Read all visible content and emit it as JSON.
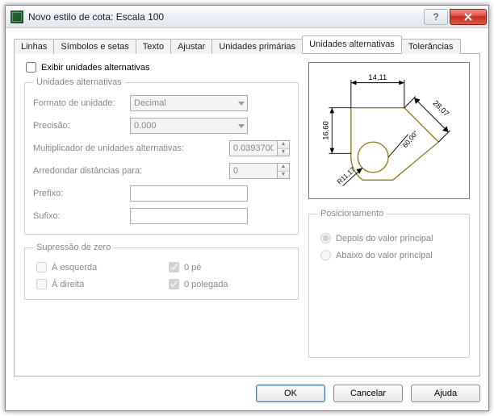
{
  "window": {
    "title": "Novo estilo de cota: Escala 100"
  },
  "tabs": {
    "t0": "Linhas",
    "t1": "Símbolos e setas",
    "t2": "Texto",
    "t3": "Ajustar",
    "t4": "Unidades primárias",
    "t5": "Unidades alternativas",
    "t6": "Tolerâncias"
  },
  "alt": {
    "show_label": "Exibir unidades alternativas",
    "group_label": "Unidades alternativas",
    "format_label": "Formato de unidade:",
    "format_value": "Decimal",
    "precision_label": "Precisão:",
    "precision_value": "0.000",
    "multiplier_label": "Multiplicador de unidades alternativas:",
    "multiplier_value": "0.0393700",
    "round_label": "Arredondar distâncias para:",
    "round_value": "0",
    "prefix_label": "Prefixo:",
    "prefix_value": "",
    "suffix_label": "Sufixo:",
    "suffix_value": ""
  },
  "zero": {
    "group_label": "Supressão de zero",
    "leading": "À esquerda",
    "trailing": "À direita",
    "feet": "0 pé",
    "inches": "0 polegada"
  },
  "placement": {
    "group_label": "Posicionamento",
    "after": "Depois do valor principal",
    "below": "Abaixo do valor principal"
  },
  "preview": {
    "d_top": "14,11",
    "d_left": "16,60",
    "d_diag": "28,07",
    "d_angle": "60,00°",
    "d_radius": "R11,17"
  },
  "buttons": {
    "ok": "OK",
    "cancel": "Cancelar",
    "help": "Ajuda"
  }
}
